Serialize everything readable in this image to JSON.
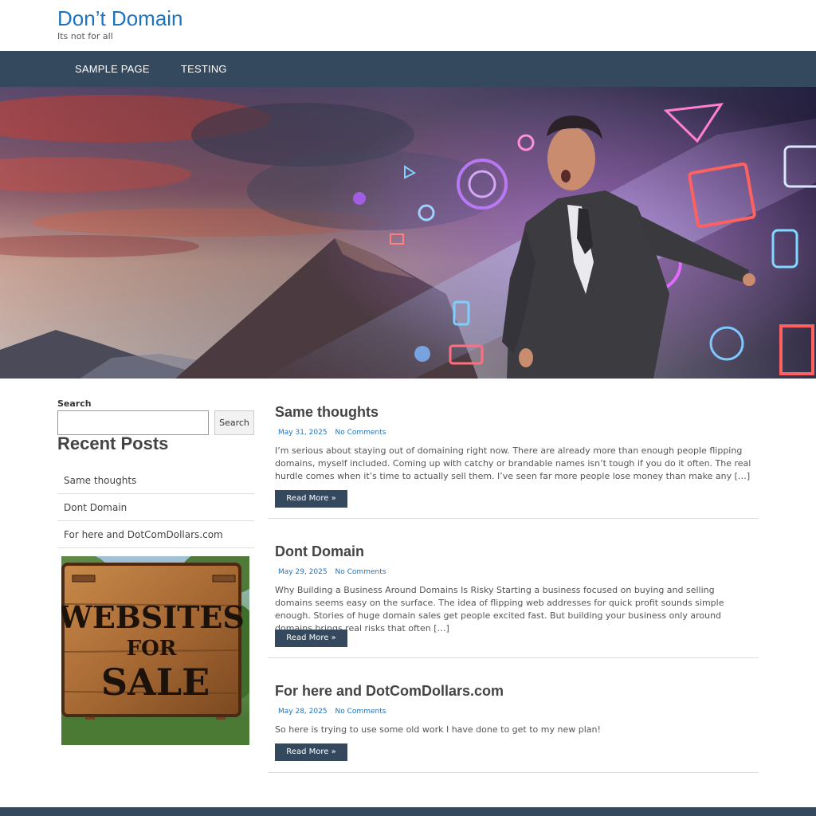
{
  "site": {
    "title": "Don’t Domain",
    "tagline": "Its not for all"
  },
  "nav": {
    "items": [
      "SAMPLE PAGE",
      "TESTING"
    ]
  },
  "sidebar": {
    "search": {
      "label": "Search",
      "button": "Search",
      "value": "",
      "placeholder": ""
    },
    "recent_posts_title": "Recent Posts",
    "recent_posts": [
      "Same thoughts",
      "Dont Domain",
      "For here and DotComDollars.com"
    ],
    "sign": {
      "line1": "WEBSITES",
      "line2": "FOR",
      "line3": "SALE"
    }
  },
  "posts": [
    {
      "title": "Same thoughts",
      "date": "May 31, 2025",
      "comments": "No Comments",
      "excerpt": "I’m serious about staying out of domaining right now. There are already more than enough people flipping domains, myself included. Coming up with catchy or brandable names isn’t tough if you do it often. The real hurdle comes when it’s time to actually sell them. I’ve seen far more people lose money than make any […]",
      "read_more": "Read More »"
    },
    {
      "title": "Dont Domain",
      "date": "May 29, 2025",
      "comments": "No Comments",
      "excerpt": "Why Building a Business Around Domains Is Risky Starting a business focused on buying and selling domains seems easy on the surface. The idea of flipping web addresses for quick profit sounds simple enough. Stories of huge domain sales get people excited fast. But building your business only around domains brings real risks that often […]",
      "read_more": "Read More »"
    },
    {
      "title": "For here and DotComDollars.com",
      "date": "May 28, 2025",
      "comments": "No Comments",
      "excerpt": "So here is trying to use some old work I have done to get to my new plan!",
      "read_more": "Read More »"
    }
  ],
  "colors": {
    "brand_blue": "#1e73be",
    "nav_bg": "#34495e"
  }
}
